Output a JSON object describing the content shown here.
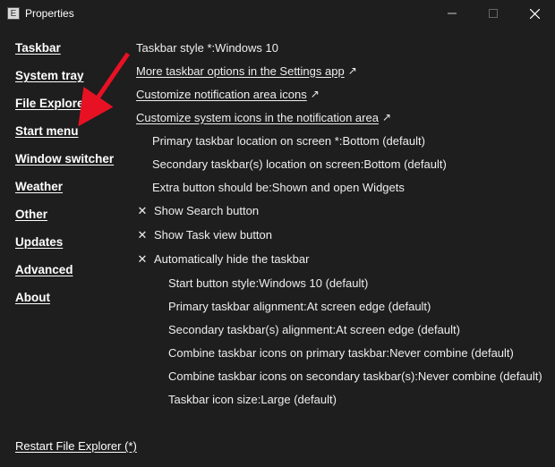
{
  "titlebar": {
    "title": "Properties"
  },
  "sidebar": {
    "items": [
      "Taskbar",
      "System tray",
      "File Explorer",
      "Start menu",
      "Window switcher",
      "Weather",
      "Other",
      "Updates",
      "Advanced",
      "About"
    ]
  },
  "main": {
    "rows": [
      {
        "kind": "plain",
        "label": "Taskbar style *",
        "value": "Windows 10"
      },
      {
        "kind": "link",
        "label": "More taskbar options in the Settings app"
      },
      {
        "kind": "link",
        "label": "Customize notification area icons"
      },
      {
        "kind": "link",
        "label": "Customize system icons in the notification area"
      },
      {
        "kind": "sub",
        "label": "Primary taskbar location on screen *",
        "value": "Bottom (default)"
      },
      {
        "kind": "sub",
        "label": "Secondary taskbar(s) location on screen",
        "value": "Bottom (default)"
      },
      {
        "kind": "sub",
        "label": "Extra button should be",
        "value": "Shown and open Widgets"
      },
      {
        "kind": "toggle",
        "label": "Show Search button"
      },
      {
        "kind": "toggle",
        "label": "Show Task view button"
      },
      {
        "kind": "toggle",
        "label": "Automatically hide the taskbar"
      },
      {
        "kind": "sub2",
        "label": "Start button style",
        "value": "Windows 10 (default)"
      },
      {
        "kind": "sub2",
        "label": "Primary taskbar alignment",
        "value": "At screen edge (default)"
      },
      {
        "kind": "sub2",
        "label": "Secondary taskbar(s) alignment",
        "value": "At screen edge (default)"
      },
      {
        "kind": "sub2",
        "label": "Combine taskbar icons on primary taskbar",
        "value": "Never combine (default)"
      },
      {
        "kind": "sub2",
        "label": "Combine taskbar icons on secondary taskbar(s)",
        "value": "Never combine (default)"
      },
      {
        "kind": "sub2",
        "label": "Taskbar icon size",
        "value": "Large (default)"
      }
    ]
  },
  "footer": {
    "restart": "Restart File Explorer (*)"
  }
}
